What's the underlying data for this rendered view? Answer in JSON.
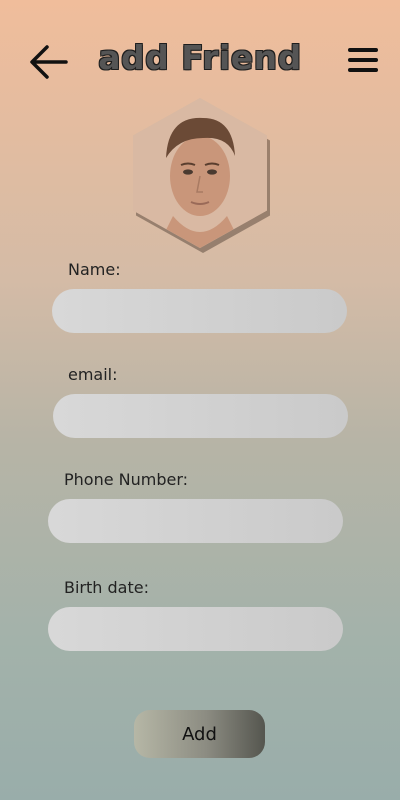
{
  "header": {
    "title": "add Friend",
    "back_icon": "arrow-left-icon",
    "menu_icon": "hamburger-menu-icon"
  },
  "avatar": {
    "icon": "profile-photo-hexagon"
  },
  "form": {
    "name_label": "Name:",
    "name_value": "",
    "email_label": "email:",
    "email_value": "",
    "phone_label": "Phone Number:",
    "phone_value": "",
    "birth_label": "Birth date:",
    "birth_value": ""
  },
  "actions": {
    "add_label": "Add"
  },
  "colors": {
    "bg_top": "#f0bd9b",
    "bg_bottom": "#99adaa",
    "input_bg": "#d3d3d3",
    "button_dark": "#55564f"
  }
}
